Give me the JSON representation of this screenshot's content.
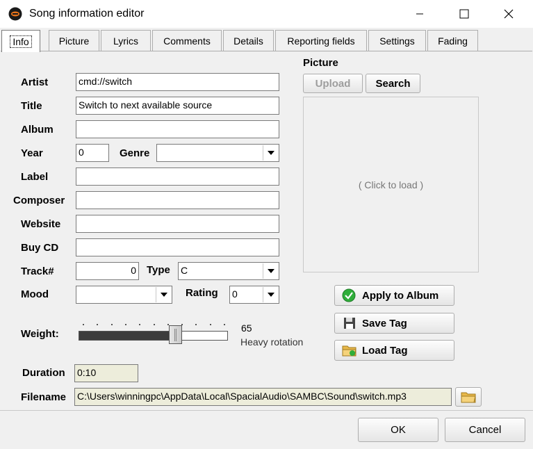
{
  "window": {
    "title": "Song information editor",
    "minimize_glyph": "–",
    "maximize_glyph": "☐",
    "close_glyph": "✕"
  },
  "tabs": [
    {
      "label": "Info",
      "active": true
    },
    {
      "label": "Picture"
    },
    {
      "label": "Lyrics"
    },
    {
      "label": "Comments"
    },
    {
      "label": "Details"
    },
    {
      "label": "Reporting fields"
    },
    {
      "label": "Settings"
    },
    {
      "label": "Fading"
    }
  ],
  "info": {
    "artist_label": "Artist",
    "artist_value": "cmd://switch",
    "title_label": "Title",
    "title_value": "Switch to next available source",
    "album_label": "Album",
    "album_value": "",
    "year_label": "Year",
    "year_value": "0",
    "genre_label": "Genre",
    "genre_value": "",
    "label_label": "Label",
    "label_value": "",
    "composer_label": "Composer",
    "composer_value": "",
    "website_label": "Website",
    "website_value": "",
    "buycd_label": "Buy CD",
    "buycd_value": "",
    "track_label": "Track#",
    "track_value": "0",
    "type_label": "Type",
    "type_value": "C",
    "mood_label": "Mood",
    "mood_value": "",
    "rating_label": "Rating",
    "rating_value": "0",
    "weight_label": "Weight:",
    "weight_value": "65",
    "weight_description": "Heavy rotation",
    "weight_fraction": 0.65,
    "duration_label": "Duration",
    "duration_value": "0:10",
    "filename_label": "Filename",
    "filename_value": "C:\\Users\\winningpc\\AppData\\Local\\SpacialAudio\\SAMBC\\Sound\\switch.mp3"
  },
  "picture": {
    "heading": "Picture",
    "upload_label": "Upload",
    "search_label": "Search",
    "placeholder": "( Click to load )"
  },
  "actions": {
    "apply_album_label": "Apply to Album",
    "save_tag_label": "Save Tag",
    "load_tag_label": "Load Tag"
  },
  "footer": {
    "ok_label": "OK",
    "cancel_label": "Cancel"
  },
  "colors": {
    "readonly_field": "#ededdb",
    "apply_icon": "#2fae3a",
    "folder_icon": "#e8b84a"
  }
}
